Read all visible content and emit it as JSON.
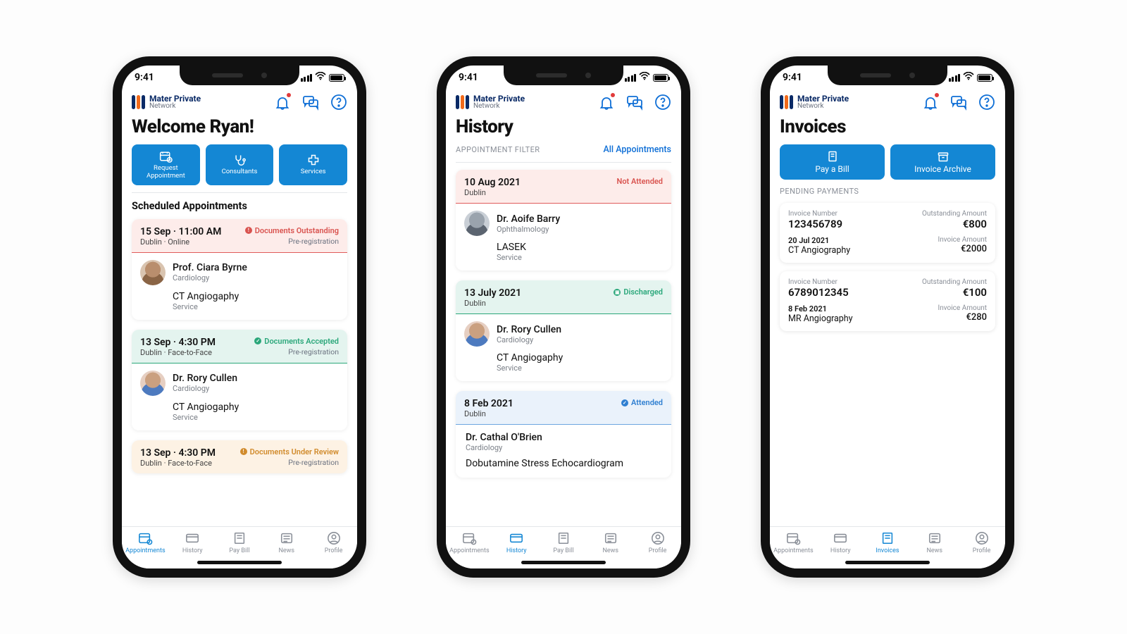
{
  "statusbar": {
    "time": "9:41"
  },
  "brand": {
    "name": "Mater Private",
    "sub": "Network"
  },
  "screens": {
    "welcome": {
      "title": "Welcome Ryan!",
      "buttons": {
        "request": "Request\nAppointment",
        "consultants": "Consultants",
        "services": "Services"
      },
      "section": "Scheduled Appointments",
      "appts": [
        {
          "date": "15 Sep · 11:00 AM",
          "loc": "Dublin · Online",
          "status": "Documents Outstanding",
          "status_sub": "Pre-registration",
          "doctor": "Prof. Ciara Byrne",
          "specialty": "Cardiology",
          "service": "CT Angiogaphy",
          "service_lbl": "Service"
        },
        {
          "date": "13 Sep · 4:30 PM",
          "loc": "Dublin · Face-to-Face",
          "status": "Documents Accepted",
          "status_sub": "Pre-registration",
          "doctor": "Dr. Rory Cullen",
          "specialty": "Cardiology",
          "service": "CT Angiogaphy",
          "service_lbl": "Service"
        },
        {
          "date": "13 Sep · 4:30 PM",
          "loc": "Dublin · Face-to-Face",
          "status": "Documents Under Review",
          "status_sub": "Pre-registration"
        }
      ]
    },
    "history": {
      "title": "History",
      "filter_label": "APPOINTMENT FILTER",
      "filter_value": "All Appointments",
      "items": [
        {
          "date": "10 Aug 2021",
          "loc": "Dublin",
          "status": "Not Attended",
          "doctor": "Dr. Aoife Barry",
          "specialty": "Ophthalmology",
          "service": "LASEK",
          "service_lbl": "Service"
        },
        {
          "date": "13 July 2021",
          "loc": "Dublin",
          "status": "Discharged",
          "doctor": "Dr. Rory Cullen",
          "specialty": "Cardiology",
          "service": "CT Angiogaphy",
          "service_lbl": "Service"
        },
        {
          "date": "8 Feb 2021",
          "loc": "Dublin",
          "status": "Attended",
          "doctor": "Dr. Cathal O'Brien",
          "specialty": "Cardiology",
          "service": "Dobutamine Stress Echocardiogram"
        }
      ]
    },
    "invoices": {
      "title": "Invoices",
      "buttons": {
        "pay": "Pay a Bill",
        "archive": "Invoice Archive"
      },
      "section": "PENDING PAYMENTS",
      "labels": {
        "invno": "Invoice Number",
        "outstanding": "Outstanding Amount",
        "invamt": "Invoice Amount"
      },
      "items": [
        {
          "number": "123456789",
          "outstanding": "€800",
          "date": "20 Jul 2021",
          "service": "CT Angiography",
          "amount": "€2000"
        },
        {
          "number": "6789012345",
          "outstanding": "€100",
          "date": "8 Feb 2021",
          "service": "MR Angiography",
          "amount": "€280"
        }
      ]
    }
  },
  "tabs": {
    "appointments": "Appointments",
    "history": "History",
    "paybill": "Pay Bill",
    "invoices": "Invoices",
    "news": "News",
    "profile": "Profile"
  }
}
